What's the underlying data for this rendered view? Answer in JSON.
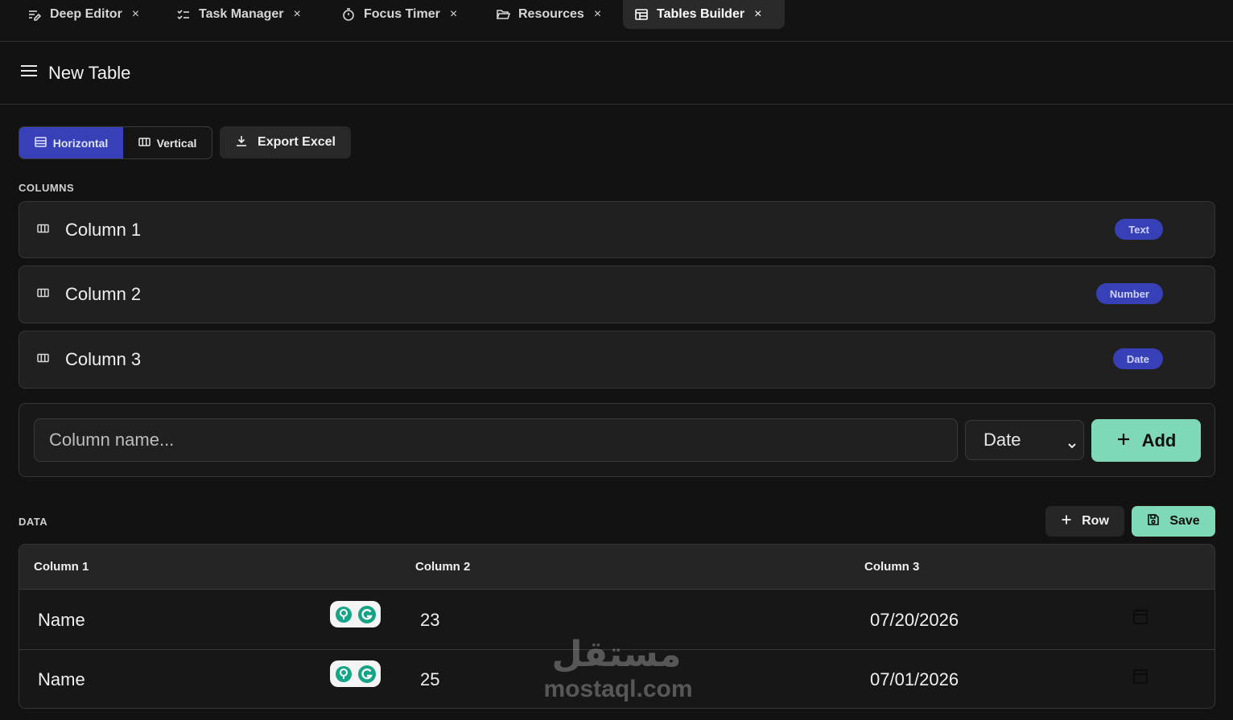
{
  "tabs": [
    {
      "label": "Deep Editor",
      "icon": "edit-lines-icon"
    },
    {
      "label": "Task Manager",
      "icon": "checklist-icon"
    },
    {
      "label": "Focus Timer",
      "icon": "timer-icon"
    },
    {
      "label": "Resources",
      "icon": "folder-open-icon"
    },
    {
      "label": "Tables Builder",
      "icon": "table-icon",
      "active": true
    }
  ],
  "close_glyph": "×",
  "header": {
    "title": "New Table"
  },
  "toolbar": {
    "layout_horizontal": "Horizontal",
    "layout_vertical": "Vertical",
    "export_label": "Export Excel"
  },
  "columns_section": {
    "label": "COLUMNS",
    "items": [
      {
        "name": "Column 1",
        "type": "Text"
      },
      {
        "name": "Column 2",
        "type": "Number"
      },
      {
        "name": "Column 3",
        "type": "Date"
      }
    ]
  },
  "add_form": {
    "placeholder": "Column name...",
    "type_value": "Date",
    "add_label": "Add"
  },
  "data_section": {
    "label": "DATA",
    "row_label": "Row",
    "save_label": "Save",
    "headers": [
      "Column 1",
      "Column 2",
      "Column 3"
    ],
    "rows": [
      [
        "Name",
        "23",
        "07/20/2026"
      ],
      [
        "Name",
        "25",
        "07/01/2026"
      ]
    ]
  },
  "watermark": {
    "arabic": "مستقل",
    "latin": "mostaql.com"
  },
  "colors": {
    "accent": "#3840b8",
    "success": "#7fd9b6",
    "background": "#121212"
  }
}
